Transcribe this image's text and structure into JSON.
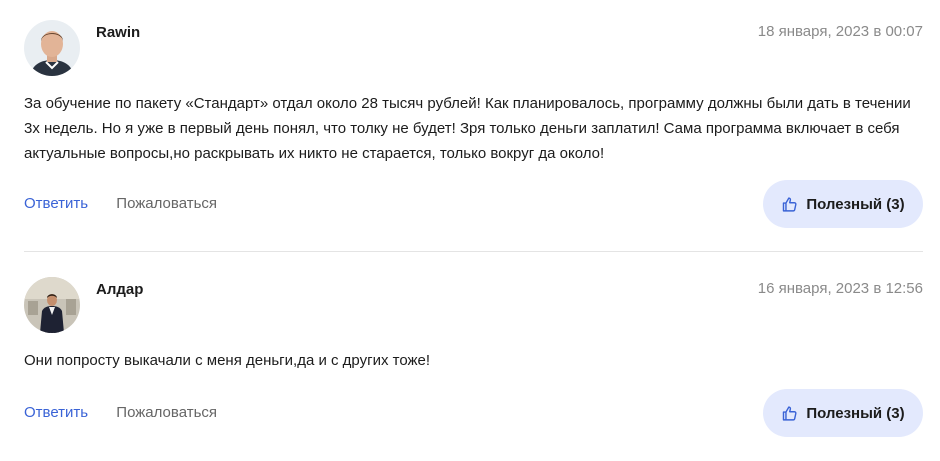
{
  "comments": [
    {
      "author": "Rawin",
      "date": "18 января, 2023 в 00:07",
      "text": "За обучение по пакету «Стандарт» отдал около 28 тысяч рублей! Как планировалось, программу должны были дать в течении 3х недель. Но я уже в первый день понял, что толку не будет! Зря только деньги заплатил! Сама программа включает в себя актуальные вопросы,но раскрывать их никто не старается, только вокруг да около!",
      "reply_label": "Ответить",
      "report_label": "Пожаловаться",
      "helpful_label": "Полезный (3)",
      "helpful_icon": "thumbs-up-icon"
    },
    {
      "author": "Алдар",
      "date": "16 января, 2023 в 12:56",
      "text": "Они попросту выкачали с меня деньги,да и с других тоже!",
      "reply_label": "Ответить",
      "report_label": "Пожаловаться",
      "helpful_label": "Полезный (3)",
      "helpful_icon": "thumbs-up-icon"
    }
  ],
  "colors": {
    "link": "#3a63d6",
    "helpful_bg": "#e3e9fd",
    "muted": "#8a8a8a"
  }
}
